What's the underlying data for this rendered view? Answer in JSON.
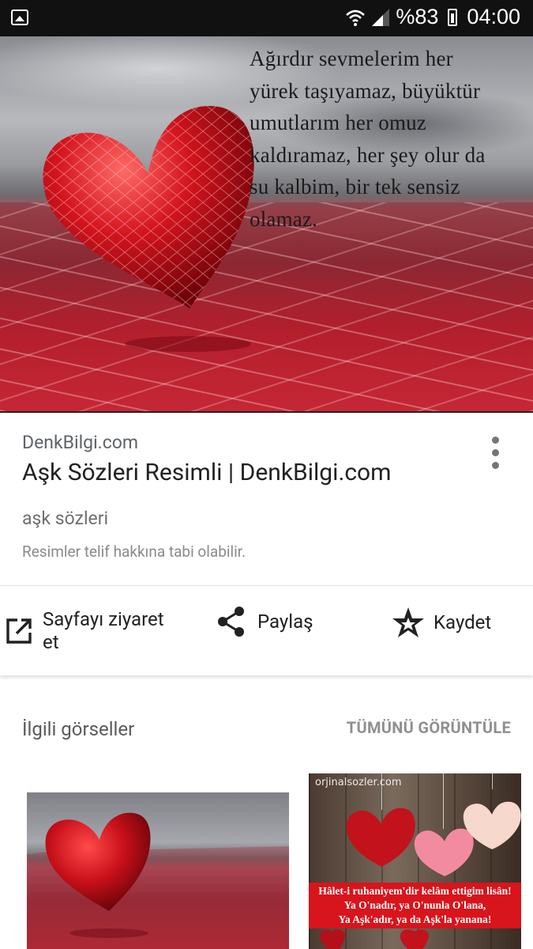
{
  "status_bar": {
    "battery": "%83",
    "time": "04:00"
  },
  "hero_image": {
    "quote": "Ağırdır sevmelerim her\nyürek taşıyamaz, büyüktür\numutlarım her omuz\nkaldıramaz, her şey olur da\nsu kalbim, bir tek sensiz\nolamaz."
  },
  "result": {
    "site": "DenkBilgi.com",
    "title": "Aşk Sözleri Resimli | DenkBilgi.com",
    "description": "aşk sözleri",
    "copyright_note": "Resimler telif hakkına tabi olabilir."
  },
  "actions": {
    "visit_line1": "Sayfayı ziyaret",
    "visit_line2": "et",
    "share": "Paylaş",
    "save": "Kaydet"
  },
  "related": {
    "title": "İlgili görseller",
    "view_all": "TÜMÜNÜ GÖRÜNTÜLE",
    "thumb2_watermark": "orjinalsozler.com",
    "thumb2_caption": "Hâlet-i ruhaniyem'dir kelâm ettigim lisân!\nYa O'nadır, ya O'nunla O'lana,\nYa Aşk'adır, ya da Aşk'la yanana!"
  },
  "icons": {
    "status_left": "gallery-icon",
    "visit": "open-in-new-icon",
    "share": "share-icon",
    "save": "star-save-icon",
    "more": "more-vert-icon"
  }
}
